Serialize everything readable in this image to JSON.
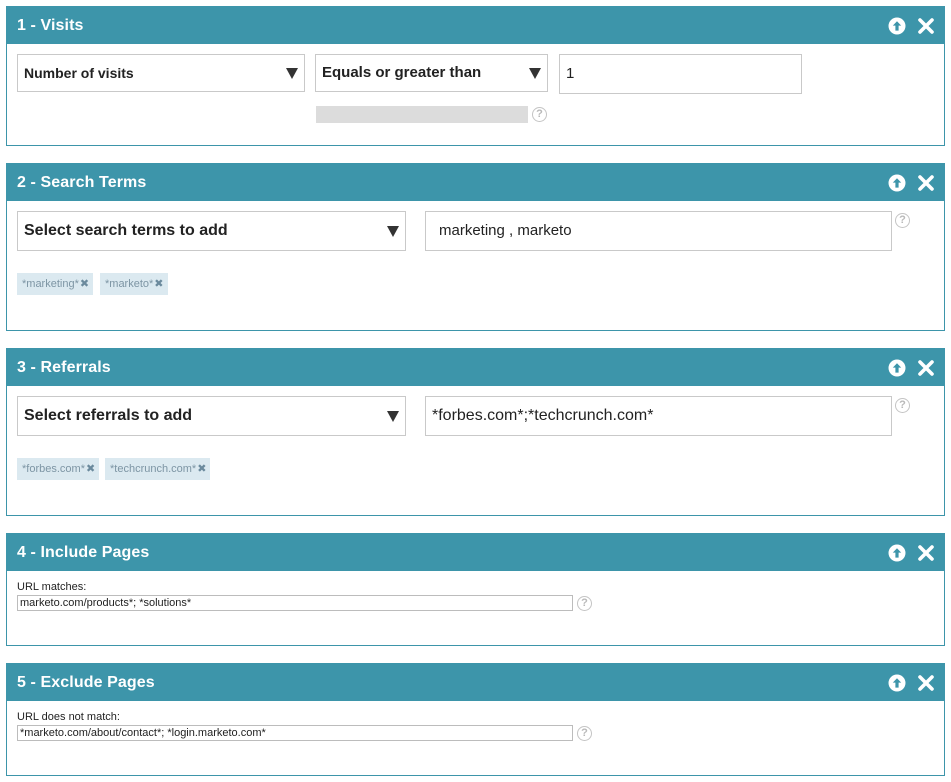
{
  "panels": [
    {
      "title": "1 - Visits",
      "field_select": "Number of visits",
      "operator_select": "Equals or greater than",
      "value": "1"
    },
    {
      "title": "2 - Search Terms",
      "select_label": "Select search terms to add",
      "input_value": "marketing , marketo",
      "tags": [
        {
          "label": "*marketing*"
        },
        {
          "label": "*marketo*"
        }
      ]
    },
    {
      "title": "3 - Referrals",
      "select_label": "Select referrals to add",
      "input_value": "*forbes.com*;*techcrunch.com*",
      "tags": [
        {
          "label": "*forbes.com*"
        },
        {
          "label": "*techcrunch.com*"
        }
      ]
    },
    {
      "title": "4 - Include Pages",
      "field_label": "URL matches:",
      "input_value": "marketo.com/products*; *solutions*"
    },
    {
      "title": "5 - Exclude Pages",
      "field_label": "URL does not match:",
      "input_value": "*marketo.com/about/contact*; *login.marketo.com*"
    }
  ],
  "icons": {
    "move_up": "arrow-up-circle-icon",
    "remove": "close-x-icon",
    "help": "question-mark-icon",
    "tag_remove": "x-icon",
    "help_glyph": "?",
    "tag_remove_glyph": "✖"
  },
  "colors": {
    "header_bg": "#3d95aa",
    "tag_bg": "#dbe9f0",
    "tag_text": "#7d95a4"
  }
}
